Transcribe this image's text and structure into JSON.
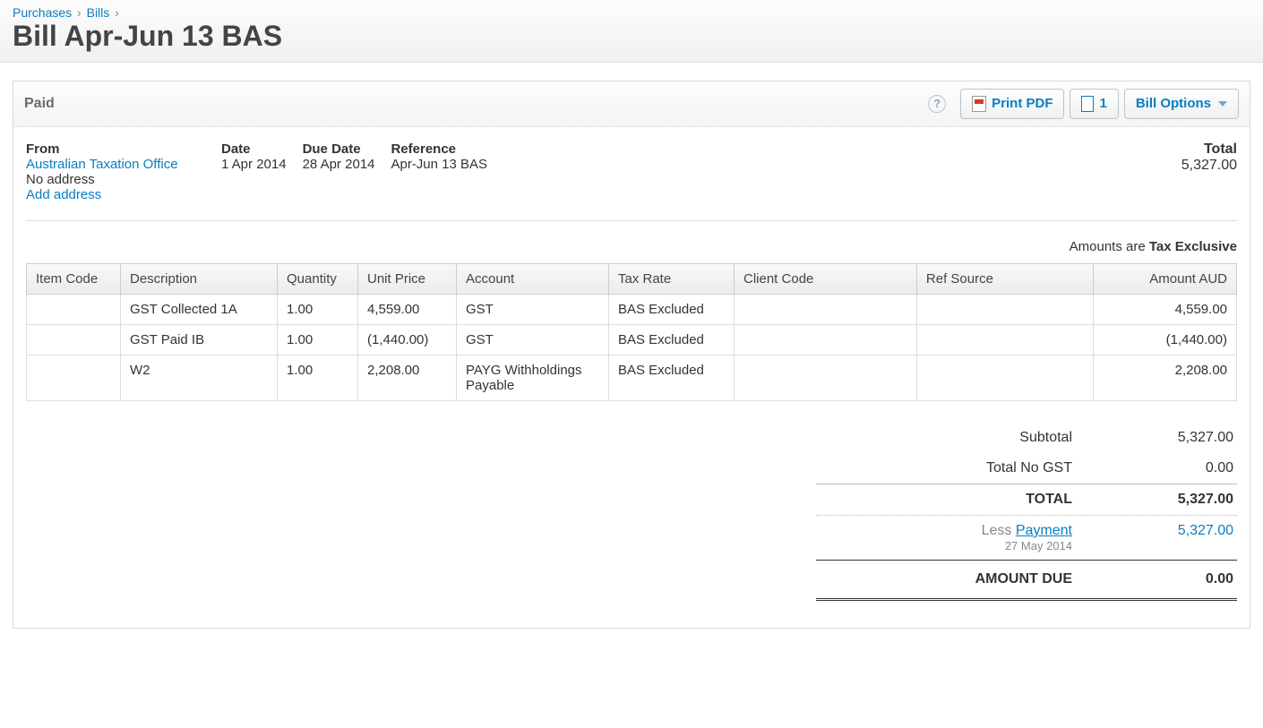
{
  "breadcrumb": {
    "level1": "Purchases",
    "level2": "Bills"
  },
  "page_title": "Bill Apr-Jun 13 BAS",
  "toolbar": {
    "status": "Paid",
    "print_pdf": "Print PDF",
    "files_count": "1",
    "bill_options": "Bill Options"
  },
  "info": {
    "from_label": "From",
    "from_name": "Australian Taxation Office",
    "from_address": "No address",
    "add_address": "Add address",
    "date_label": "Date",
    "date_value": "1 Apr 2014",
    "due_label": "Due Date",
    "due_value": "28 Apr 2014",
    "ref_label": "Reference",
    "ref_value": "Apr-Jun 13 BAS",
    "total_label": "Total",
    "total_value": "5,327.00"
  },
  "amounts_note_prefix": "Amounts are ",
  "amounts_note_bold": "Tax Exclusive",
  "columns": {
    "item_code": "Item Code",
    "description": "Description",
    "quantity": "Quantity",
    "unit_price": "Unit Price",
    "account": "Account",
    "tax_rate": "Tax Rate",
    "client_code": "Client Code",
    "ref_source": "Ref Source",
    "amount": "Amount AUD"
  },
  "lines": [
    {
      "item_code": "",
      "description": "GST Collected 1A",
      "quantity": "1.00",
      "unit_price": "4,559.00",
      "account": "GST",
      "tax_rate": "BAS Excluded",
      "client_code": "",
      "ref_source": "",
      "amount": "4,559.00"
    },
    {
      "item_code": "",
      "description": "GST Paid IB",
      "quantity": "1.00",
      "unit_price": "(1,440.00)",
      "account": "GST",
      "tax_rate": "BAS Excluded",
      "client_code": "",
      "ref_source": "",
      "amount": "(1,440.00)"
    },
    {
      "item_code": "",
      "description": "W2",
      "quantity": "1.00",
      "unit_price": "2,208.00",
      "account": "PAYG Withholdings Payable",
      "tax_rate": "BAS Excluded",
      "client_code": "",
      "ref_source": "",
      "amount": "2,208.00"
    }
  ],
  "totals": {
    "subtotal_label": "Subtotal",
    "subtotal_value": "5,327.00",
    "nogst_label": "Total No GST",
    "nogst_value": "0.00",
    "total_label": "TOTAL",
    "total_value": "5,327.00",
    "less_prefix": "Less ",
    "payment_link": "Payment",
    "payment_date": "27 May 2014",
    "payment_value": "5,327.00",
    "due_label": "AMOUNT DUE",
    "due_value": "0.00"
  }
}
